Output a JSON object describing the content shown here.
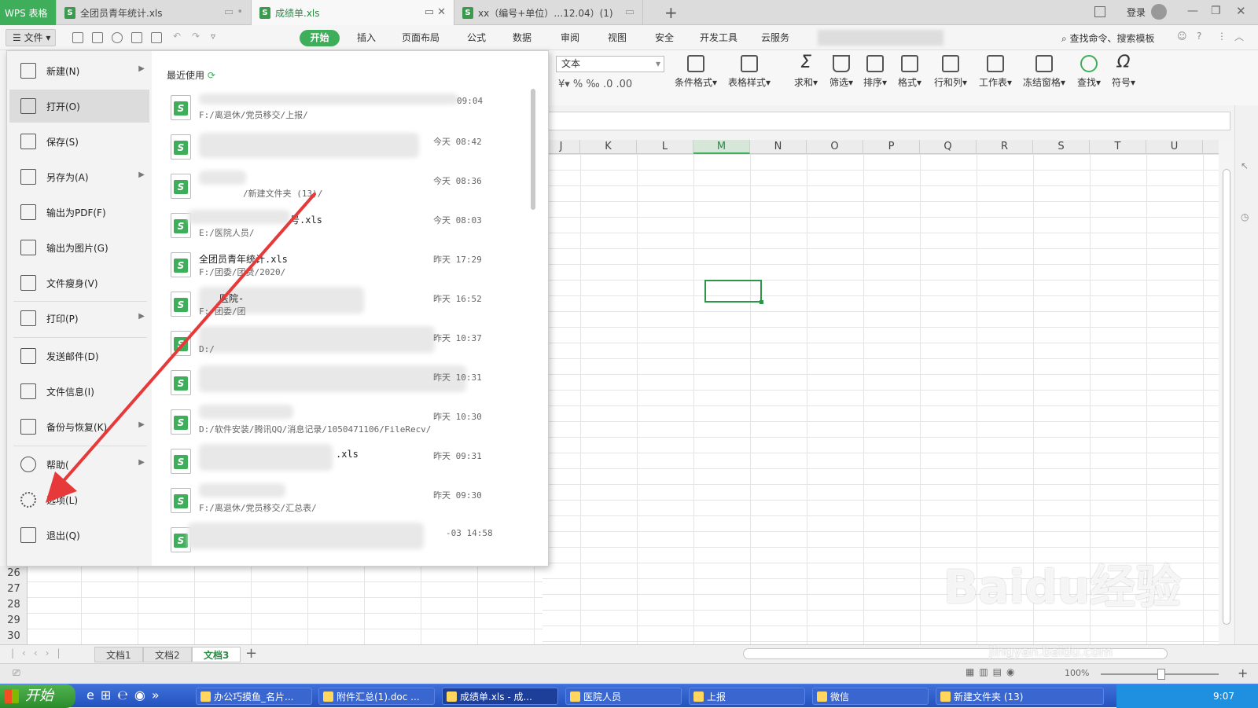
{
  "window_tabs": [
    {
      "label": "WPS 表格",
      "type": "app"
    },
    {
      "label": "全团员青年统计.xls",
      "type": "doc"
    },
    {
      "label": "成绩单.xls",
      "type": "doc",
      "active": true
    },
    {
      "label": "xx（编号+单位）…12.04）(1)",
      "type": "doc"
    }
  ],
  "title_right": {
    "login": "登录"
  },
  "file_button": "文件",
  "ribbon_tabs": [
    "开始",
    "插入",
    "页面布局",
    "公式",
    "数据",
    "审阅",
    "视图",
    "安全",
    "开发工具",
    "云服务"
  ],
  "search_hint": "查找命令、搜索模板",
  "ribbon": {
    "number_format": "文本",
    "buttons": [
      "条件格式",
      "表格样式",
      "求和",
      "筛选",
      "排序",
      "格式",
      "行和列",
      "工作表",
      "冻结窗格",
      "查找",
      "符号"
    ]
  },
  "columns": [
    "J",
    "K",
    "L",
    "M",
    "N",
    "O",
    "P",
    "Q",
    "R",
    "S",
    "T",
    "U"
  ],
  "selected_column": "M",
  "rows": [
    "26",
    "27",
    "28",
    "29",
    "30"
  ],
  "file_menu": {
    "items": [
      {
        "label": "新建(N)",
        "icon": "new-file-icon",
        "submenu": true
      },
      {
        "label": "打开(O)",
        "icon": "open-folder-icon",
        "highlighted": true
      },
      {
        "label": "保存(S)",
        "icon": "save-icon"
      },
      {
        "label": "另存为(A)",
        "icon": "save-as-icon",
        "submenu": true
      },
      {
        "label": "输出为PDF(F)",
        "icon": "export-pdf-icon"
      },
      {
        "label": "输出为图片(G)",
        "icon": "export-image-icon"
      },
      {
        "label": "文件瘦身(V)",
        "icon": "slim-file-icon"
      },
      {
        "label": "打印(P)",
        "icon": "print-icon",
        "submenu": true
      },
      {
        "label": "发送邮件(D)",
        "icon": "mail-icon"
      },
      {
        "label": "文件信息(I)",
        "icon": "file-info-icon"
      },
      {
        "label": "备份与恢复(K)",
        "icon": "backup-icon",
        "submenu": true
      },
      {
        "label": "帮助(",
        "icon": "help-icon",
        "submenu": true
      },
      {
        "label": "选项(L)",
        "icon": "gear-icon"
      },
      {
        "label": "退出(Q)",
        "icon": "exit-icon"
      }
    ],
    "recent_label": "最近使用",
    "recent": [
      {
        "name": "",
        "path": "F:/离退休/党员移交/上报/",
        "time": "09:04"
      },
      {
        "name": "",
        "path": "",
        "time": "今天 08:42"
      },
      {
        "name": "",
        "path": "/新建文件夹 (13)/",
        "time": "今天 08:36"
      },
      {
        "name": "号.xls",
        "path": "E:/医院人员/",
        "time": "今天 08:03"
      },
      {
        "name": "全团员青年统计.xls",
        "path": "F:/团委/团费/2020/",
        "time": "昨天 17:29"
      },
      {
        "name": "医院-",
        "path": "F:/团委/团",
        "time": "昨天 16:52"
      },
      {
        "name": "",
        "path": "D:/",
        "time": "昨天 10:37"
      },
      {
        "name": "",
        "path": "",
        "time": "昨天 10:31"
      },
      {
        "name": "",
        "path": "D:/软件安装/腾讯QQ/消息记录/1050471106/FileRecv/",
        "time": "昨天 10:30"
      },
      {
        "name": ".xls",
        "path": "",
        "time": "昨天 09:31"
      },
      {
        "name": "",
        "path": "F:/离退休/党员移交/汇总表/",
        "time": "昨天 09:30"
      },
      {
        "name": "",
        "path": "",
        "time": "-03 14:58"
      }
    ]
  },
  "sheet_tabs": [
    "文档1",
    "文档2",
    "文档3"
  ],
  "active_sheet": "文档3",
  "zoom": "100%",
  "taskbar": {
    "start": "开始",
    "items": [
      "办公巧摸鱼_名片...",
      "附件汇总(1).doc ...",
      "成绩单.xls - 成...",
      "医院人员",
      "上报",
      "微信",
      "新建文件夹 (13)"
    ],
    "active": "成绩单.xls - 成...",
    "clock": "9:07"
  },
  "watermark": {
    "main": "Baidu经验",
    "sub": "jingyan.baidu.com"
  },
  "colors": {
    "accent": "#3fae5a",
    "arrow": "#e8393a",
    "taskbar": "#2a5bc8"
  }
}
